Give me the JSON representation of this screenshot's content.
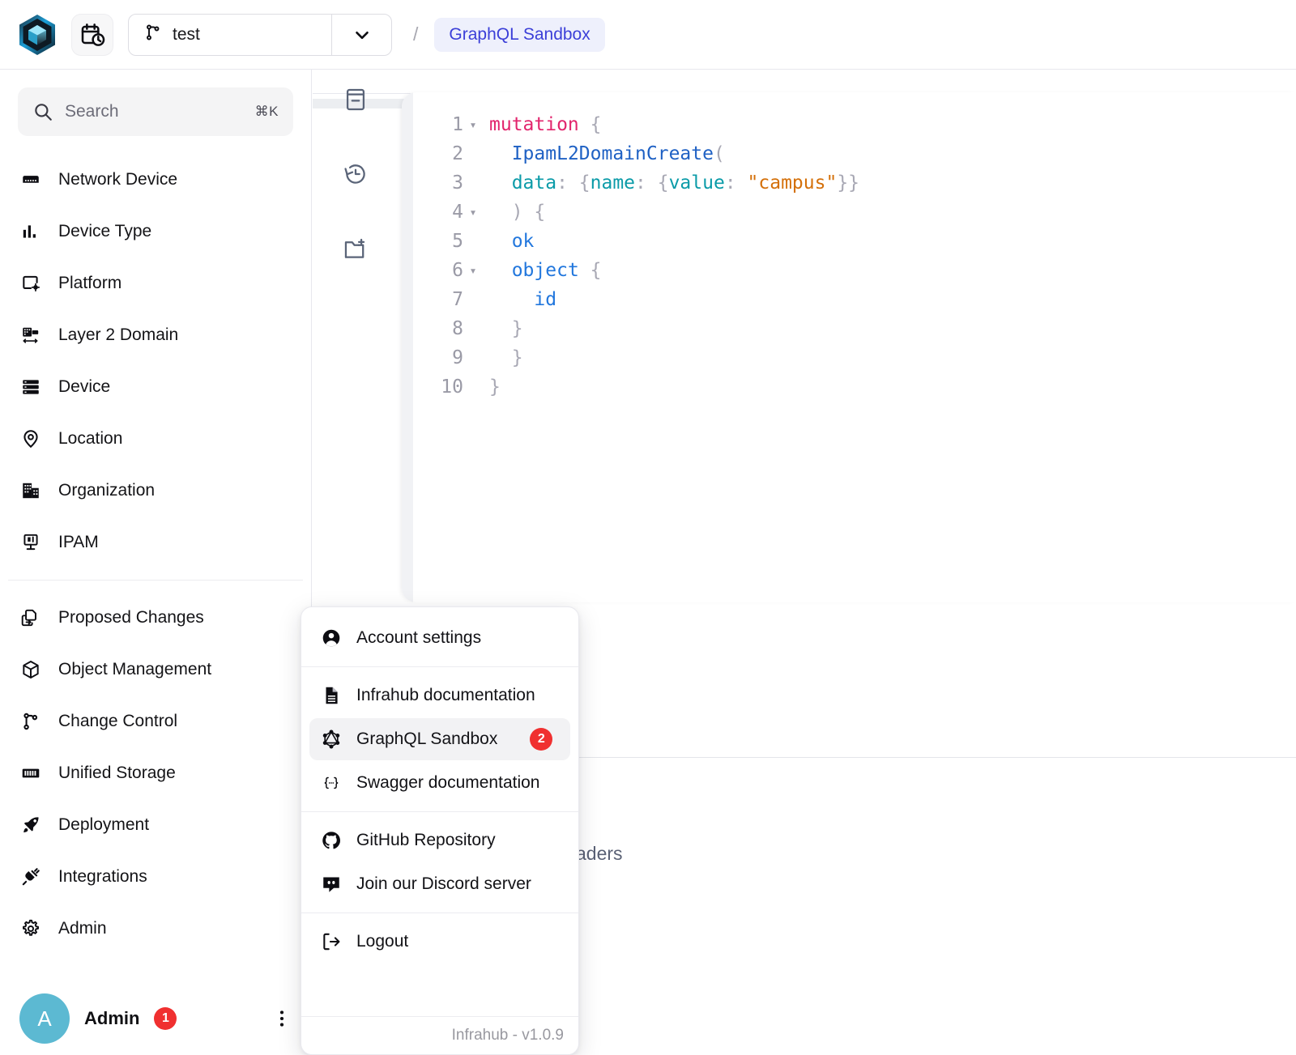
{
  "topbar": {
    "logo_icon": "infrahub-hexagon-logo",
    "calendar_icon": "calendar-clock-icon",
    "branch": {
      "icon": "git-branch-icon",
      "value": "test",
      "caret_icon": "chevron-down-icon"
    },
    "breadcrumb_separator": "/",
    "breadcrumb_current": "GraphQL Sandbox"
  },
  "sidebar": {
    "search": {
      "icon": "search-icon",
      "placeholder": "Search",
      "shortcut": "⌘K"
    },
    "groups": [
      {
        "items": [
          {
            "label": "Network Device",
            "icon": "network-device-icon"
          },
          {
            "label": "Device Type",
            "icon": "device-type-icon"
          },
          {
            "label": "Platform",
            "icon": "platform-icon"
          },
          {
            "label": "Layer 2 Domain",
            "icon": "layer2-domain-icon"
          },
          {
            "label": "Device",
            "icon": "device-icon"
          },
          {
            "label": "Location",
            "icon": "location-pin-icon"
          },
          {
            "label": "Organization",
            "icon": "organization-building-icon"
          },
          {
            "label": "IPAM",
            "icon": "ipam-icon"
          }
        ]
      },
      {
        "items": [
          {
            "label": "Proposed Changes",
            "icon": "proposed-changes-icon"
          },
          {
            "label": "Object Management",
            "icon": "cube-icon"
          },
          {
            "label": "Change Control",
            "icon": "git-branch-icon"
          },
          {
            "label": "Unified Storage",
            "icon": "unified-storage-icon"
          },
          {
            "label": "Deployment",
            "icon": "rocket-icon"
          },
          {
            "label": "Integrations",
            "icon": "plug-icon"
          },
          {
            "label": "Admin",
            "icon": "gear-icon"
          }
        ]
      }
    ],
    "user": {
      "avatar_initial": "A",
      "name": "Admin",
      "badge": "1",
      "more_icon": "more-vertical-icon"
    }
  },
  "main": {
    "tools": [
      {
        "icon": "docs-panel-icon"
      },
      {
        "icon": "history-clock-icon"
      },
      {
        "icon": "new-folder-icon"
      }
    ],
    "editor": {
      "lines": [
        {
          "n": "1",
          "fold": "▾",
          "tokens": [
            {
              "t": "kw",
              "v": "mutation"
            },
            {
              "t": "p",
              "v": " {"
            }
          ]
        },
        {
          "n": "2",
          "fold": "",
          "tokens": [
            {
              "t": "p",
              "v": "  "
            },
            {
              "t": "fn",
              "v": "IpamL2DomainCreate"
            },
            {
              "t": "p",
              "v": "("
            }
          ]
        },
        {
          "n": "3",
          "fold": "",
          "tokens": [
            {
              "t": "p",
              "v": "  "
            },
            {
              "t": "arg",
              "v": "data"
            },
            {
              "t": "p",
              "v": ": {"
            },
            {
              "t": "arg",
              "v": "name"
            },
            {
              "t": "p",
              "v": ": {"
            },
            {
              "t": "arg",
              "v": "value"
            },
            {
              "t": "p",
              "v": ": "
            },
            {
              "t": "str",
              "v": "\"campus\""
            },
            {
              "t": "p",
              "v": "}}"
            }
          ]
        },
        {
          "n": "4",
          "fold": "▾",
          "tokens": [
            {
              "t": "p",
              "v": "  ) {"
            }
          ]
        },
        {
          "n": "5",
          "fold": "",
          "tokens": [
            {
              "t": "p",
              "v": "  "
            },
            {
              "t": "field",
              "v": "ok"
            }
          ]
        },
        {
          "n": "6",
          "fold": "▾",
          "tokens": [
            {
              "t": "p",
              "v": "  "
            },
            {
              "t": "field",
              "v": "object"
            },
            {
              "t": "p",
              "v": " {"
            }
          ]
        },
        {
          "n": "7",
          "fold": "",
          "tokens": [
            {
              "t": "p",
              "v": "    "
            },
            {
              "t": "field",
              "v": "id"
            }
          ]
        },
        {
          "n": "8",
          "fold": "",
          "tokens": [
            {
              "t": "p",
              "v": "  }"
            }
          ]
        },
        {
          "n": "9",
          "fold": "",
          "tokens": [
            {
              "t": "p",
              "v": "  }"
            }
          ]
        },
        {
          "n": "10",
          "fold": "",
          "tokens": [
            {
              "t": "p",
              "v": "}"
            }
          ]
        }
      ]
    },
    "obscured_tab_text": "aders"
  },
  "user_menu": {
    "sections": [
      {
        "items": [
          {
            "label": "Account settings",
            "icon": "account-circle-icon",
            "active": false,
            "badge": ""
          }
        ]
      },
      {
        "items": [
          {
            "label": "Infrahub documentation",
            "icon": "document-icon",
            "active": false,
            "badge": ""
          },
          {
            "label": "GraphQL Sandbox",
            "icon": "graphql-icon",
            "active": true,
            "badge": "2"
          },
          {
            "label": "Swagger documentation",
            "icon": "braces-icon",
            "active": false,
            "badge": ""
          }
        ]
      },
      {
        "items": [
          {
            "label": "GitHub Repository",
            "icon": "github-icon",
            "active": false,
            "badge": ""
          },
          {
            "label": "Join our Discord server",
            "icon": "discord-icon",
            "active": false,
            "badge": ""
          }
        ]
      },
      {
        "items": [
          {
            "label": "Logout",
            "icon": "logout-icon",
            "active": false,
            "badge": ""
          }
        ]
      }
    ],
    "version": "Infrahub - v1.0.9"
  },
  "colors": {
    "accent_indigo": "#3b3fd8",
    "breadcrumb_bg": "#eef0fc",
    "badge_red": "#f03030",
    "avatar_teal": "#5cb9d2",
    "menu_active_bg": "#f2f2f4"
  }
}
